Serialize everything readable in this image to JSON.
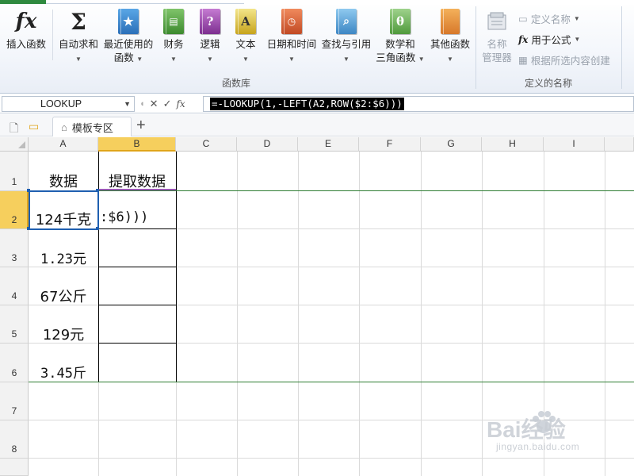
{
  "ribbon": {
    "insert_function": "插入函数",
    "autosum": "自动求和",
    "recent_line1": "最近使用的",
    "recent_line2": "函数",
    "financial": "财务",
    "logical": "逻辑",
    "text": "文本",
    "datetime": "日期和时间",
    "lookup": "查找与引用",
    "math_line1": "数学和",
    "math_line2": "三角函数",
    "other": "其他函数",
    "group_function_library": "函数库",
    "name_manager_line1": "名称",
    "name_manager_line2": "管理器",
    "define_name": "定义名称",
    "use_in_formula": "用于公式",
    "create_from_selection": "根据所选内容创建",
    "group_defined_names": "定义的名称",
    "icon_fx": "fx",
    "icon_sigma": "Σ",
    "icon_logic": "?",
    "icon_text": "A",
    "icon_math": "θ"
  },
  "formula_bar": {
    "name_box": "LOOKUP",
    "fx_label": "fx",
    "formula": "=-LOOKUP(1,-LEFT(A2,ROW($2:$6)))"
  },
  "tabs": {
    "sheet_tab": "模板专区"
  },
  "grid": {
    "columns": [
      "A",
      "B",
      "C",
      "D",
      "E",
      "F",
      "G",
      "H",
      "I"
    ],
    "rows": [
      "1",
      "2",
      "3",
      "4",
      "5",
      "6",
      "7",
      "8"
    ],
    "cells": {
      "A1": "数据",
      "B1": "提取数据",
      "A2": "124千克",
      "B2": ":$6)))",
      "A3": "1.23元",
      "A4": "67公斤",
      "A5": "129元",
      "A6": "3.45斤"
    }
  },
  "watermark": {
    "brand": "Bai经验",
    "url": "jingyan.baidu.com"
  },
  "colors": {
    "selected_header": "#f6cf5d",
    "active_cell_border": "#1f5fb0",
    "green_line": "#2e7d32"
  }
}
